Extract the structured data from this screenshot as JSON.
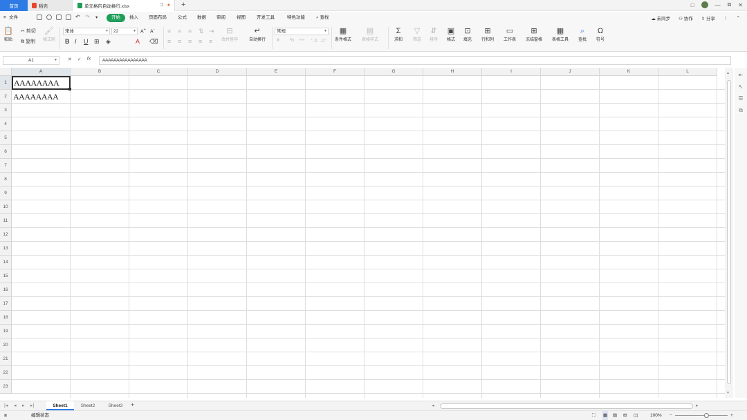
{
  "titlebar": {
    "home_tab": "首页",
    "docer_tab": "稻壳",
    "file_tab": "单元格内自动换行.xlsx",
    "new_tab_glyph": "+",
    "window_buttons": [
      "□",
      "—",
      "⧉",
      "✕"
    ]
  },
  "menu": {
    "file": "文件",
    "items": [
      "开始",
      "插入",
      "页面布局",
      "公式",
      "数据",
      "审阅",
      "视图",
      "开发工具",
      "特色功能"
    ],
    "active": "开始",
    "search": "查找",
    "right": [
      "未同步",
      "协作",
      "分享"
    ]
  },
  "ribbon": {
    "paste": "粘贴",
    "cut": "剪切",
    "copy": "复制",
    "format_painter": "格式刷",
    "font_name": "宋体",
    "font_size": "22",
    "bold": "B",
    "italic": "I",
    "underline": "U",
    "merge_center": "合并居中",
    "wrap_text": "自动换行",
    "number_format": "常规",
    "percent": "%",
    "currency": "¥",
    "conditional_format": "条件格式",
    "table_style": "表格样式",
    "sum": "求和",
    "filter": "筛选",
    "sort": "排序",
    "format": "格式",
    "fill": "填充",
    "rows_cols": "行和列",
    "worksheet": "工作表",
    "freeze": "冻结窗格",
    "table_tools": "表格工具",
    "find": "查找",
    "symbol": "符号"
  },
  "formula_bar": {
    "name_box": "A1",
    "cancel": "✕",
    "confirm": "✓",
    "fx": "fx",
    "content": "AAAAAAAAAAAAAAAA"
  },
  "grid": {
    "columns": [
      "A",
      "B",
      "C",
      "D",
      "E",
      "F",
      "G",
      "H",
      "I",
      "J",
      "K",
      "L"
    ],
    "rows": [
      "1",
      "2",
      "3",
      "4",
      "5",
      "6",
      "7",
      "8",
      "9",
      "10",
      "11",
      "12",
      "13",
      "14",
      "15",
      "16",
      "17",
      "18",
      "19",
      "20",
      "21",
      "22",
      "23"
    ],
    "selected_cell": "A1",
    "cells": {
      "A1": "AAAAAAAA",
      "A2": "AAAAAAAA"
    }
  },
  "sheets": {
    "tabs": [
      "Sheet1",
      "Sheet2",
      "Sheet3"
    ],
    "active": "Sheet1",
    "add": "+"
  },
  "status": {
    "mode": "编辑状态",
    "zoom": "100%"
  }
}
